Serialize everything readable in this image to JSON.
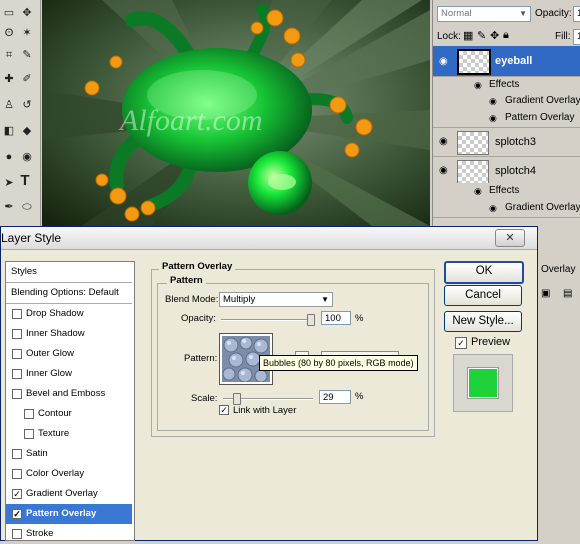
{
  "canvas": {
    "watermark": "Alfoart.com"
  },
  "layers_panel": {
    "blend_mode": "Normal",
    "opacity_label": "Opacity:",
    "opacity_value": "1",
    "lock_label": "Lock:",
    "fill_label": "Fill:",
    "fill_value": "1",
    "rows": [
      {
        "name": "eyeball",
        "selected": true
      },
      {
        "effects_label": "Effects"
      },
      {
        "effect": "Gradient Overlay"
      },
      {
        "effect": "Pattern Overlay"
      },
      {
        "name": "splotch3"
      },
      {
        "name": "splotch4"
      },
      {
        "effects_label": "Effects"
      },
      {
        "effect": "Gradient Overlay"
      }
    ],
    "partial_row": "Overlay"
  },
  "dialog": {
    "title": "Layer Style",
    "styles_header": "Styles",
    "blending_options": "Blending Options: Default",
    "items": [
      {
        "label": "Drop Shadow",
        "checked": false
      },
      {
        "label": "Inner Shadow",
        "checked": false
      },
      {
        "label": "Outer Glow",
        "checked": false
      },
      {
        "label": "Inner Glow",
        "checked": false
      },
      {
        "label": "Bevel and Emboss",
        "checked": false
      },
      {
        "label": "Contour",
        "checked": false
      },
      {
        "label": "Texture",
        "checked": false
      },
      {
        "label": "Satin",
        "checked": false
      },
      {
        "label": "Color Overlay",
        "checked": false
      },
      {
        "label": "Gradient Overlay",
        "checked": true
      },
      {
        "label": "Pattern Overlay",
        "checked": true
      },
      {
        "label": "Stroke",
        "checked": false
      }
    ],
    "section_title": "Pattern Overlay",
    "group_title": "Pattern",
    "blend_mode_label": "Blend Mode:",
    "blend_mode_value": "Multiply",
    "opacity_label": "Opacity:",
    "opacity_value": "100",
    "opacity_unit": "%",
    "opacity_fraction": 1.0,
    "pattern_label": "Pattern:",
    "pattern_tooltip": "Bubbles (80 by 80 pixels, RGB mode)",
    "scale_label": "Scale:",
    "scale_value": "29",
    "scale_unit": "%",
    "scale_fraction": 0.03,
    "link_with_layer_label": "Link with Layer",
    "link_with_layer_checked": true,
    "ok_label": "OK",
    "cancel_label": "Cancel",
    "new_style_label": "New Style...",
    "preview_label": "Preview",
    "preview_checked": true,
    "preview_color": "#1fd23a"
  }
}
